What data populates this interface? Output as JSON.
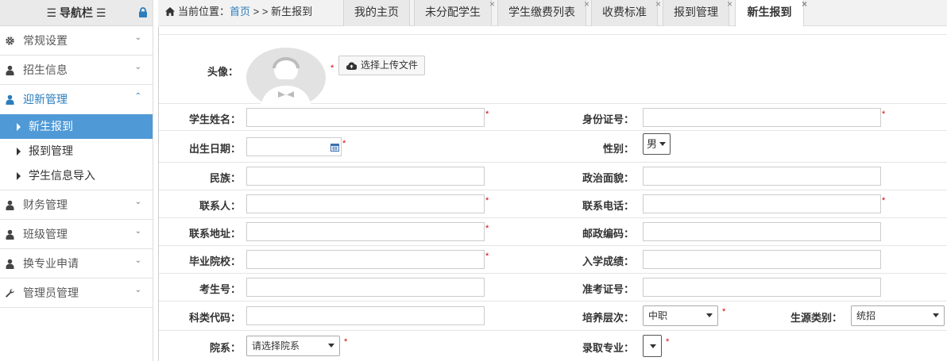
{
  "nav": {
    "title": "☰ 导航栏 ☰",
    "menus": [
      {
        "label": "常规设置",
        "icon": "gear-icon"
      },
      {
        "label": "招生信息",
        "icon": "user-icon"
      },
      {
        "label": "迎新管理",
        "icon": "user-icon",
        "active": true
      }
    ],
    "submenus": [
      {
        "label": "新生报到",
        "selected": true
      },
      {
        "label": "报到管理"
      },
      {
        "label": "学生信息导入"
      }
    ],
    "menus_after": [
      {
        "label": "财务管理",
        "icon": "user-icon"
      },
      {
        "label": "班级管理",
        "icon": "user-icon"
      },
      {
        "label": "换专业申请",
        "icon": "user-icon"
      },
      {
        "label": "管理员管理",
        "icon": "wrench-icon"
      }
    ]
  },
  "breadcrumb": {
    "prefix": "当前位置：",
    "home": "首页",
    "sep": " > > ",
    "current": "新生报到"
  },
  "tabs": [
    {
      "label": "我的主页"
    },
    {
      "label": "未分配学生"
    },
    {
      "label": "学生缴费列表"
    },
    {
      "label": "收费标准"
    },
    {
      "label": "报到管理"
    },
    {
      "label": "新生报到"
    }
  ],
  "tab_close": "×",
  "required_mark": "*",
  "form": {
    "avatar_label": "头像：",
    "upload_label": "选择上传文件",
    "name_label": "学生姓名：",
    "id_label": "身份证号：",
    "birth_label": "出生日期：",
    "gender_label": "性别：",
    "gender_value": "男",
    "ethnic_label": "民族：",
    "political_label": "政治面貌：",
    "contact_label": "联系人：",
    "phone_label": "联系电话：",
    "address_label": "联系地址：",
    "postcode_label": "邮政编码：",
    "school_label": "毕业院校：",
    "score_label": "入学成绩：",
    "examno_label": "考生号：",
    "ticket_label": "准考证号：",
    "subject_label": "科类代码：",
    "level_label": "培养层次：",
    "level_value": "中职",
    "source_label": "生源类别：",
    "source_value": "统招",
    "dept_label": "院系：",
    "dept_value": "请选择院系",
    "major_label": "录取专业："
  }
}
